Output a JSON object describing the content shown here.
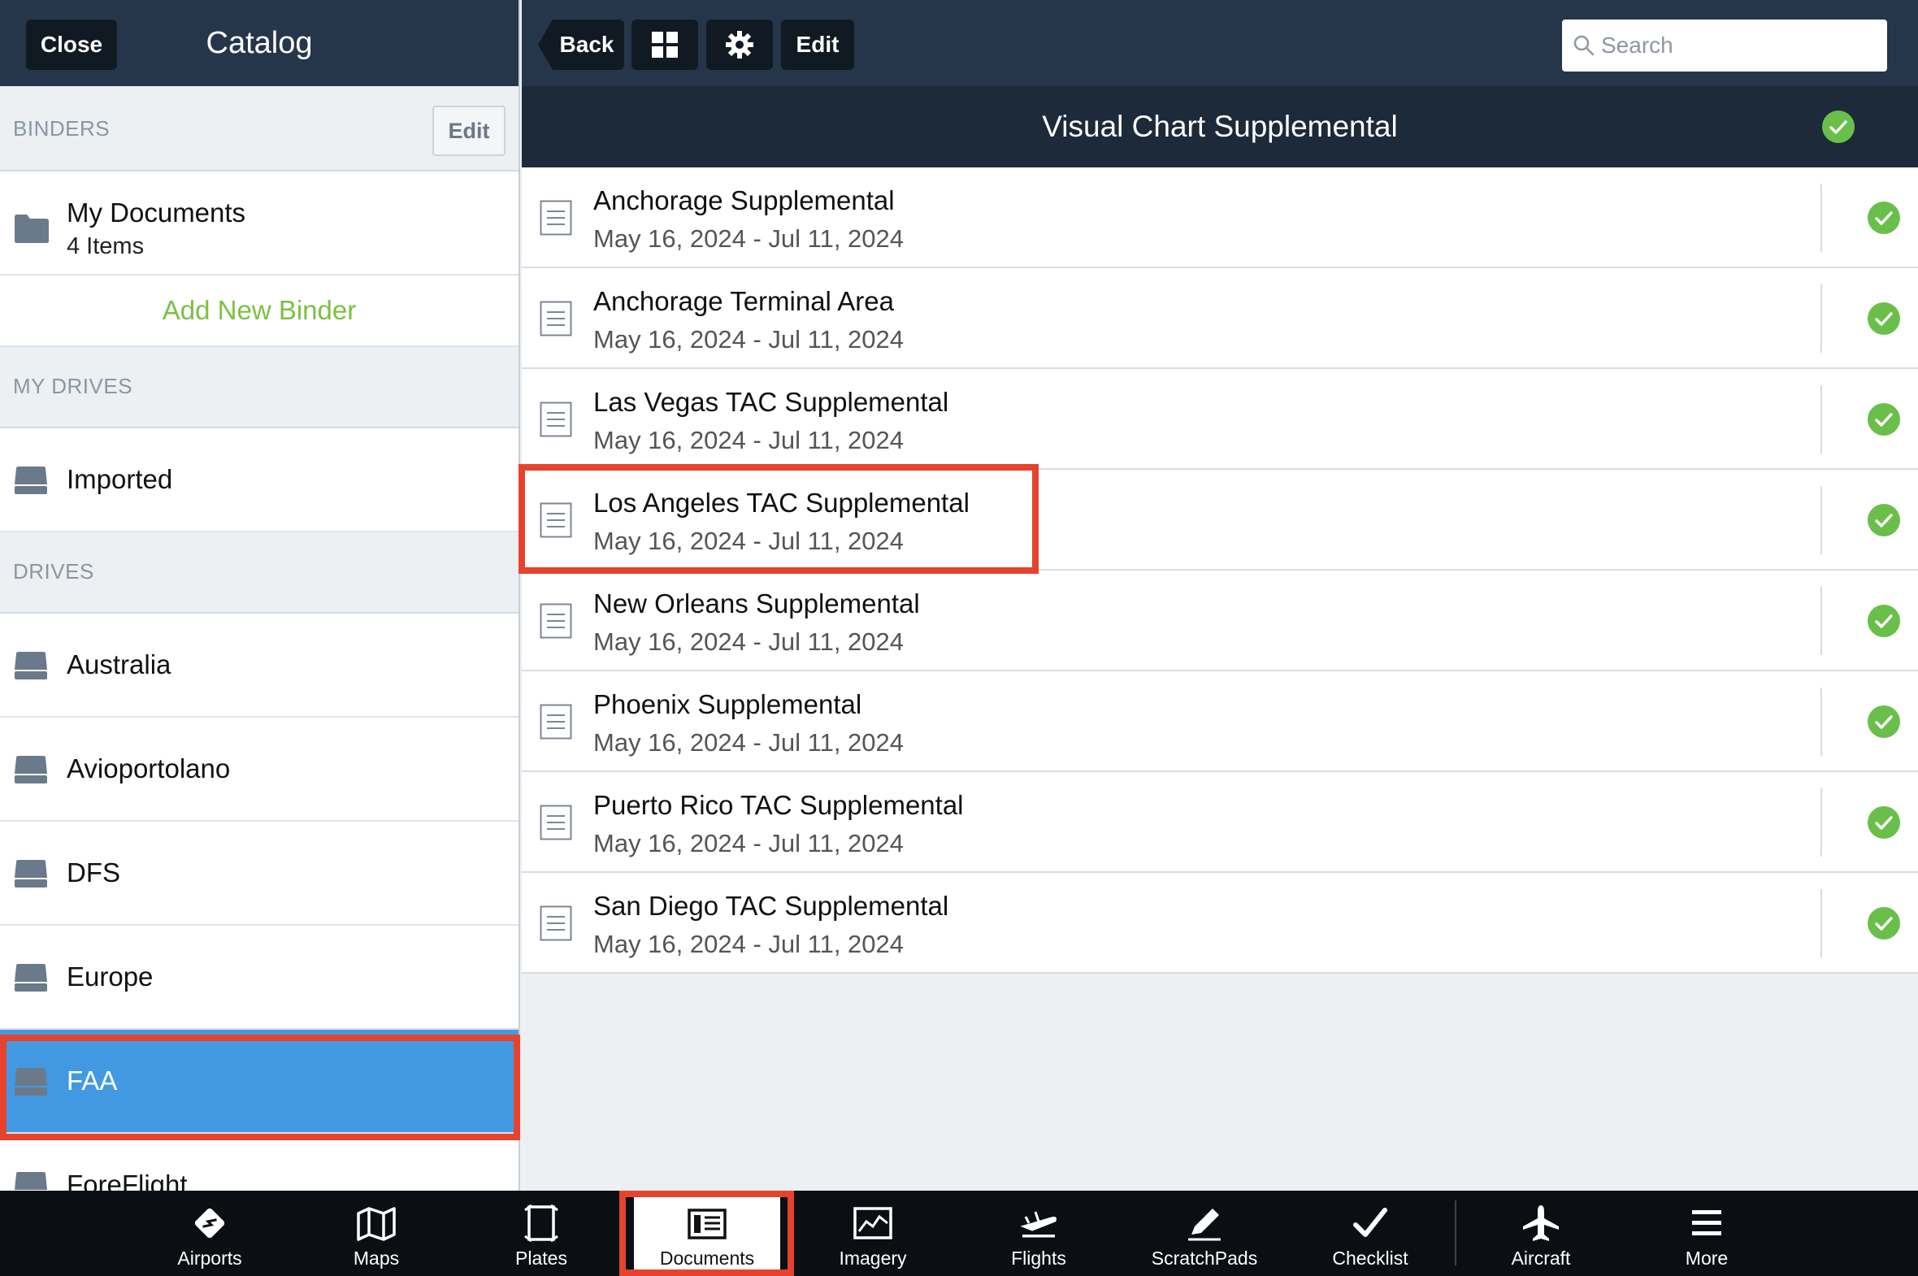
{
  "sidebar": {
    "close_label": "Close",
    "title": "Catalog",
    "binders": {
      "section_label": "BINDERS",
      "edit_label": "Edit",
      "my_documents": {
        "title": "My Documents",
        "count": "4 Items"
      },
      "add_binder_label": "Add New Binder"
    },
    "my_drives": {
      "section_label": "MY DRIVES",
      "items": [
        {
          "label": "Imported"
        }
      ]
    },
    "drives": {
      "section_label": "DRIVES",
      "items": [
        {
          "label": "Australia"
        },
        {
          "label": "Avioportolano"
        },
        {
          "label": "DFS"
        },
        {
          "label": "Europe"
        },
        {
          "label": "FAA",
          "selected": true
        },
        {
          "label": "ForeFlight"
        }
      ]
    }
  },
  "toolbar": {
    "back_label": "Back",
    "edit_label": "Edit",
    "search_placeholder": "Search",
    "grid_icon": "grid-icon",
    "gear_icon": "gear-icon"
  },
  "list": {
    "header": "Visual Chart Supplemental",
    "items": [
      {
        "title": "Anchorage Supplemental",
        "dates": "May 16, 2024 - Jul 11, 2024"
      },
      {
        "title": "Anchorage Terminal Area",
        "dates": "May 16, 2024 - Jul 11, 2024"
      },
      {
        "title": "Las Vegas TAC Supplemental",
        "dates": "May 16, 2024 - Jul 11, 2024"
      },
      {
        "title": "Los Angeles TAC Supplemental",
        "dates": "May 16, 2024 - Jul 11, 2024"
      },
      {
        "title": "New Orleans Supplemental",
        "dates": "May 16, 2024 - Jul 11, 2024"
      },
      {
        "title": "Phoenix Supplemental",
        "dates": "May 16, 2024 - Jul 11, 2024"
      },
      {
        "title": "Puerto Rico TAC Supplemental",
        "dates": "May 16, 2024 - Jul 11, 2024"
      },
      {
        "title": "San Diego TAC Supplemental",
        "dates": "May 16, 2024 - Jul 11, 2024"
      }
    ]
  },
  "tabbar": {
    "tabs": [
      {
        "label": "Airports"
      },
      {
        "label": "Maps"
      },
      {
        "label": "Plates"
      },
      {
        "label": "Documents",
        "active": true
      },
      {
        "label": "Imagery"
      },
      {
        "label": "Flights"
      },
      {
        "label": "ScratchPads"
      },
      {
        "label": "Checklist"
      },
      {
        "label": "Aircraft"
      },
      {
        "label": "More"
      }
    ]
  },
  "colors": {
    "nav_dark": "#26364a",
    "selected_blue": "#4299e1",
    "accent_green": "#7bc142",
    "check_green": "#6abf4b",
    "highlight_red": "#e6422e"
  }
}
